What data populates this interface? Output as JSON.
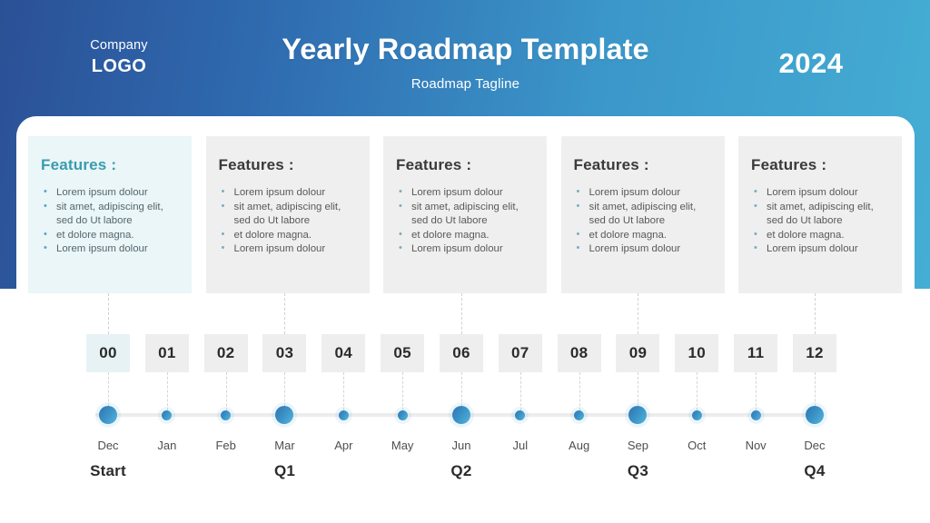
{
  "header": {
    "logo_company": "Company",
    "logo_word": "LOGO",
    "title": "Yearly Roadmap Template",
    "tagline": "Roadmap Tagline",
    "year": "2024",
    "gradient_from": "#2b5096",
    "gradient_to": "#45aed4"
  },
  "cards": [
    {
      "title": "Features :",
      "accent": true,
      "bullets": [
        "Lorem ipsum dolour",
        "sit amet, adipiscing elit, sed do Ut labore",
        "et dolore magna.",
        "Lorem ipsum dolour"
      ]
    },
    {
      "title": "Features :",
      "accent": false,
      "bullets": [
        "Lorem ipsum dolour",
        "sit amet, adipiscing elit, sed do Ut labore",
        "et dolore magna.",
        "Lorem ipsum dolour"
      ]
    },
    {
      "title": "Features :",
      "accent": false,
      "bullets": [
        "Lorem ipsum dolour",
        "sit amet, adipiscing elit, sed do Ut labore",
        "et dolore magna.",
        "Lorem ipsum dolour"
      ]
    },
    {
      "title": "Features :",
      "accent": false,
      "bullets": [
        "Lorem ipsum dolour",
        "sit amet, adipiscing elit, sed do Ut labore",
        "et dolore magna.",
        "Lorem ipsum dolour"
      ]
    },
    {
      "title": "Features :",
      "accent": false,
      "bullets": [
        "Lorem ipsum dolour",
        "sit amet, adipiscing elit, sed do Ut labore",
        "et dolore magna.",
        "Lorem ipsum dolour"
      ]
    }
  ],
  "timeline": {
    "accent_color": "#3b93c6",
    "milestones": [
      {
        "number": "00",
        "month": "Dec",
        "major": true,
        "accent": true,
        "quarter": "Start"
      },
      {
        "number": "01",
        "month": "Jan",
        "major": false,
        "accent": false,
        "quarter": ""
      },
      {
        "number": "02",
        "month": "Feb",
        "major": false,
        "accent": false,
        "quarter": ""
      },
      {
        "number": "03",
        "month": "Mar",
        "major": true,
        "accent": false,
        "quarter": "Q1"
      },
      {
        "number": "04",
        "month": "Apr",
        "major": false,
        "accent": false,
        "quarter": ""
      },
      {
        "number": "05",
        "month": "May",
        "major": false,
        "accent": false,
        "quarter": ""
      },
      {
        "number": "06",
        "month": "Jun",
        "major": true,
        "accent": false,
        "quarter": "Q2"
      },
      {
        "number": "07",
        "month": "Jul",
        "major": false,
        "accent": false,
        "quarter": ""
      },
      {
        "number": "08",
        "month": "Aug",
        "major": false,
        "accent": false,
        "quarter": ""
      },
      {
        "number": "09",
        "month": "Sep",
        "major": true,
        "accent": false,
        "quarter": "Q3"
      },
      {
        "number": "10",
        "month": "Oct",
        "major": false,
        "accent": false,
        "quarter": ""
      },
      {
        "number": "11",
        "month": "Nov",
        "major": false,
        "accent": false,
        "quarter": ""
      },
      {
        "number": "12",
        "month": "Dec",
        "major": true,
        "accent": false,
        "quarter": "Q4"
      }
    ]
  }
}
